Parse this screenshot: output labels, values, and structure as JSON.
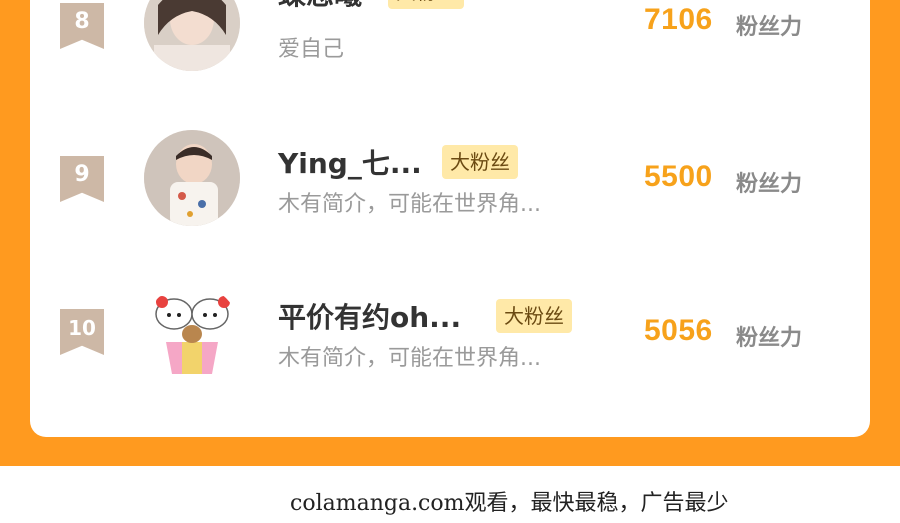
{
  "ranking": {
    "entries": [
      {
        "rank": "8",
        "name": "蝶恋曦",
        "badge": "大粉丝",
        "bio": "爱自己",
        "score": "7106",
        "score_label": "粉丝力"
      },
      {
        "rank": "9",
        "name": "Ying_七...",
        "badge": "大粉丝",
        "bio": "木有简介，可能在世界角...",
        "score": "5500",
        "score_label": "粉丝力"
      },
      {
        "rank": "10",
        "name": "平价有约oh...",
        "badge": "大粉丝",
        "bio": "木有简介，可能在世界角...",
        "score": "5056",
        "score_label": "粉丝力"
      }
    ]
  },
  "footer": {
    "watermark": "colamanga.com观看，最快最稳，广告最少"
  },
  "colors": {
    "accent": "#FF9A1F",
    "score": "#F7A21B",
    "badge_bg": "#FFE9A8",
    "rank_flag": "#CDB8A6"
  }
}
